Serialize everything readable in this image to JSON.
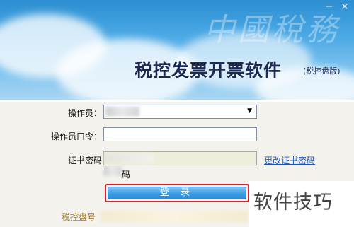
{
  "window": {
    "minimize": "−",
    "close": "×"
  },
  "banner": {
    "title": "税控发票开票软件",
    "subtitle": "(税控盘版)",
    "watermark": "中國稅務"
  },
  "form": {
    "operator_label": "操作员：",
    "operator_value": "",
    "operator_password_label": "操作员口令：",
    "cert_password_label": "证书密码",
    "change_cert_password_link": "更改证书密码",
    "remember_password_label": "码",
    "login_button": "登 录",
    "device_number_label": "税控盘号"
  },
  "watermark_brand": "软件技巧",
  "colors": {
    "banner": "#2d8fd1",
    "login_border": "#d8232a",
    "link": "#1a56b8"
  }
}
